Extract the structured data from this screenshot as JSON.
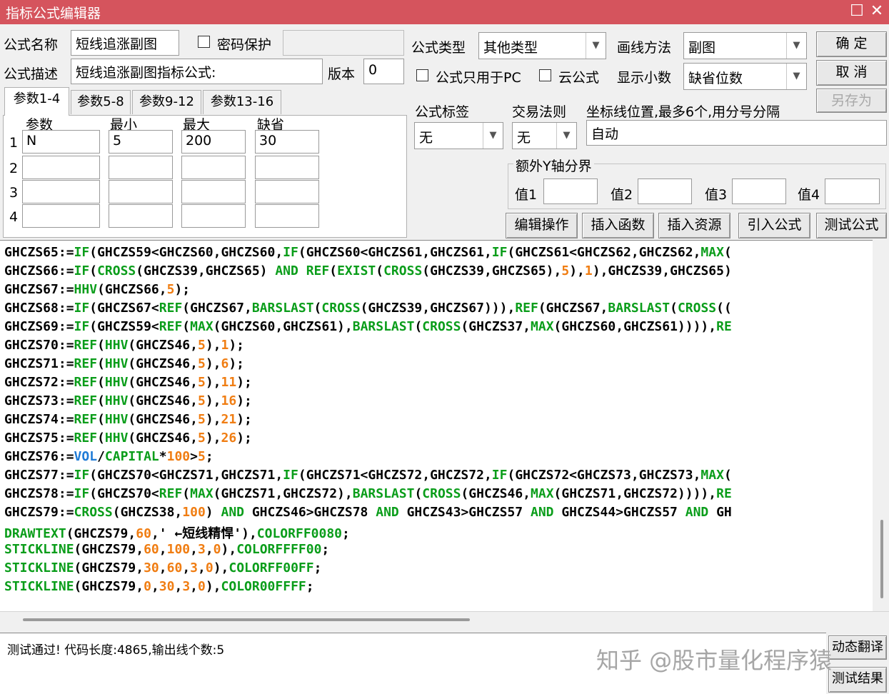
{
  "window": {
    "title": "指标公式编辑器",
    "maximize_icon": "☐",
    "close_icon": "✕"
  },
  "form": {
    "name_label": "公式名称",
    "name_value": "短线追涨副图",
    "password_label": "密码保护",
    "desc_label": "公式描述",
    "desc_value": "短线追涨副图指标公式:",
    "version_label": "版本",
    "version_value": "0",
    "type_label": "公式类型",
    "type_value": "其他类型",
    "draw_label": "画线方法",
    "draw_value": "副图",
    "pc_only_label": "公式只用于PC",
    "cloud_label": "云公式",
    "decimals_label": "显示小数",
    "decimals_value": "缺省位数",
    "tag_label": "公式标签",
    "tag_value": "无",
    "trade_label": "交易法则",
    "trade_value": "无",
    "axis_label": "坐标线位置,最多6个,用分号分隔",
    "axis_value": "自动",
    "yaxis_group_label": "额外Y轴分界",
    "y1_label": "值1",
    "y2_label": "值2",
    "y3_label": "值3",
    "y4_label": "值4"
  },
  "buttons": {
    "ok": "确  定",
    "cancel": "取  消",
    "save_as": "另存为",
    "edit": "编辑操作",
    "insert_func": "插入函数",
    "insert_res": "插入资源",
    "import": "引入公式",
    "test": "测试公式",
    "translate": "动态翻译",
    "test_result": "测试结果"
  },
  "params": {
    "tabs": [
      "参数1-4",
      "参数5-8",
      "参数9-12",
      "参数13-16"
    ],
    "headers": [
      "参数",
      "最小",
      "最大",
      "缺省"
    ],
    "rows": [
      {
        "no": "1",
        "name": "N",
        "min": "5",
        "max": "200",
        "default": "30"
      },
      {
        "no": "2",
        "name": "",
        "min": "",
        "max": "",
        "default": ""
      },
      {
        "no": "3",
        "name": "",
        "min": "",
        "max": "",
        "default": ""
      },
      {
        "no": "4",
        "name": "",
        "min": "",
        "max": "",
        "default": ""
      }
    ]
  },
  "code_lines": [
    [
      [
        "t",
        "GHCZS65:="
      ],
      [
        "k",
        "IF"
      ],
      [
        "t",
        "(GHCZS59<GHCZS60,GHCZS60,"
      ],
      [
        "k",
        "IF"
      ],
      [
        "t",
        "(GHCZS60<GHCZS61,GHCZS61,"
      ],
      [
        "k",
        "IF"
      ],
      [
        "t",
        "(GHCZS61<GHCZS62,GHCZS62,"
      ],
      [
        "k",
        "MAX"
      ],
      [
        "t",
        "("
      ]
    ],
    [
      [
        "t",
        "GHCZS66:="
      ],
      [
        "k",
        "IF"
      ],
      [
        "t",
        "("
      ],
      [
        "k",
        "CROSS"
      ],
      [
        "t",
        "(GHCZS39,GHCZS65) "
      ],
      [
        "k",
        "AND"
      ],
      [
        "t",
        " "
      ],
      [
        "k",
        "REF"
      ],
      [
        "t",
        "("
      ],
      [
        "k",
        "EXIST"
      ],
      [
        "t",
        "("
      ],
      [
        "k",
        "CROSS"
      ],
      [
        "t",
        "(GHCZS39,GHCZS65),"
      ],
      [
        "n",
        "5"
      ],
      [
        "t",
        "),"
      ],
      [
        "n",
        "1"
      ],
      [
        "t",
        "),GHCZS39,GHCZS65)"
      ]
    ],
    [
      [
        "t",
        "GHCZS67:="
      ],
      [
        "k",
        "HHV"
      ],
      [
        "t",
        "(GHCZS66,"
      ],
      [
        "n",
        "5"
      ],
      [
        "t",
        ");"
      ]
    ],
    [
      [
        "t",
        "GHCZS68:="
      ],
      [
        "k",
        "IF"
      ],
      [
        "t",
        "(GHCZS67<"
      ],
      [
        "k",
        "REF"
      ],
      [
        "t",
        "(GHCZS67,"
      ],
      [
        "k",
        "BARSLAST"
      ],
      [
        "t",
        "("
      ],
      [
        "k",
        "CROSS"
      ],
      [
        "t",
        "(GHCZS39,GHCZS67))),"
      ],
      [
        "k",
        "REF"
      ],
      [
        "t",
        "(GHCZS67,"
      ],
      [
        "k",
        "BARSLAST"
      ],
      [
        "t",
        "("
      ],
      [
        "k",
        "CROSS"
      ],
      [
        "t",
        "(("
      ]
    ],
    [
      [
        "t",
        "GHCZS69:="
      ],
      [
        "k",
        "IF"
      ],
      [
        "t",
        "(GHCZS59<"
      ],
      [
        "k",
        "REF"
      ],
      [
        "t",
        "("
      ],
      [
        "k",
        "MAX"
      ],
      [
        "t",
        "(GHCZS60,GHCZS61),"
      ],
      [
        "k",
        "BARSLAST"
      ],
      [
        "t",
        "("
      ],
      [
        "k",
        "CROSS"
      ],
      [
        "t",
        "(GHCZS37,"
      ],
      [
        "k",
        "MAX"
      ],
      [
        "t",
        "(GHCZS60,GHCZS61)))),"
      ],
      [
        "k",
        "RE"
      ]
    ],
    [
      [
        "t",
        "GHCZS70:="
      ],
      [
        "k",
        "REF"
      ],
      [
        "t",
        "("
      ],
      [
        "k",
        "HHV"
      ],
      [
        "t",
        "(GHCZS46,"
      ],
      [
        "n",
        "5"
      ],
      [
        "t",
        "),"
      ],
      [
        "n",
        "1"
      ],
      [
        "t",
        ");"
      ]
    ],
    [
      [
        "t",
        "GHCZS71:="
      ],
      [
        "k",
        "REF"
      ],
      [
        "t",
        "("
      ],
      [
        "k",
        "HHV"
      ],
      [
        "t",
        "(GHCZS46,"
      ],
      [
        "n",
        "5"
      ],
      [
        "t",
        "),"
      ],
      [
        "n",
        "6"
      ],
      [
        "t",
        ");"
      ]
    ],
    [
      [
        "t",
        "GHCZS72:="
      ],
      [
        "k",
        "REF"
      ],
      [
        "t",
        "("
      ],
      [
        "k",
        "HHV"
      ],
      [
        "t",
        "(GHCZS46,"
      ],
      [
        "n",
        "5"
      ],
      [
        "t",
        "),"
      ],
      [
        "n",
        "11"
      ],
      [
        "t",
        ");"
      ]
    ],
    [
      [
        "t",
        "GHCZS73:="
      ],
      [
        "k",
        "REF"
      ],
      [
        "t",
        "("
      ],
      [
        "k",
        "HHV"
      ],
      [
        "t",
        "(GHCZS46,"
      ],
      [
        "n",
        "5"
      ],
      [
        "t",
        "),"
      ],
      [
        "n",
        "16"
      ],
      [
        "t",
        ");"
      ]
    ],
    [
      [
        "t",
        "GHCZS74:="
      ],
      [
        "k",
        "REF"
      ],
      [
        "t",
        "("
      ],
      [
        "k",
        "HHV"
      ],
      [
        "t",
        "(GHCZS46,"
      ],
      [
        "n",
        "5"
      ],
      [
        "t",
        "),"
      ],
      [
        "n",
        "21"
      ],
      [
        "t",
        ");"
      ]
    ],
    [
      [
        "t",
        "GHCZS75:="
      ],
      [
        "k",
        "REF"
      ],
      [
        "t",
        "("
      ],
      [
        "k",
        "HHV"
      ],
      [
        "t",
        "(GHCZS46,"
      ],
      [
        "n",
        "5"
      ],
      [
        "t",
        "),"
      ],
      [
        "n",
        "26"
      ],
      [
        "t",
        ");"
      ]
    ],
    [
      [
        "t",
        "GHCZS76:="
      ],
      [
        "b",
        "VOL"
      ],
      [
        "t",
        "/"
      ],
      [
        "k",
        "CAPITAL"
      ],
      [
        "t",
        "*"
      ],
      [
        "n",
        "100"
      ],
      [
        "t",
        ">"
      ],
      [
        "n",
        "5"
      ],
      [
        "t",
        ";"
      ]
    ],
    [
      [
        "t",
        "GHCZS77:="
      ],
      [
        "k",
        "IF"
      ],
      [
        "t",
        "(GHCZS70<GHCZS71,GHCZS71,"
      ],
      [
        "k",
        "IF"
      ],
      [
        "t",
        "(GHCZS71<GHCZS72,GHCZS72,"
      ],
      [
        "k",
        "IF"
      ],
      [
        "t",
        "(GHCZS72<GHCZS73,GHCZS73,"
      ],
      [
        "k",
        "MAX"
      ],
      [
        "t",
        "("
      ]
    ],
    [
      [
        "t",
        "GHCZS78:="
      ],
      [
        "k",
        "IF"
      ],
      [
        "t",
        "(GHCZS70<"
      ],
      [
        "k",
        "REF"
      ],
      [
        "t",
        "("
      ],
      [
        "k",
        "MAX"
      ],
      [
        "t",
        "(GHCZS71,GHCZS72),"
      ],
      [
        "k",
        "BARSLAST"
      ],
      [
        "t",
        "("
      ],
      [
        "k",
        "CROSS"
      ],
      [
        "t",
        "(GHCZS46,"
      ],
      [
        "k",
        "MAX"
      ],
      [
        "t",
        "(GHCZS71,GHCZS72)))),"
      ],
      [
        "k",
        "RE"
      ]
    ],
    [
      [
        "t",
        "GHCZS79:="
      ],
      [
        "k",
        "CROSS"
      ],
      [
        "t",
        "(GHCZS38,"
      ],
      [
        "n",
        "100"
      ],
      [
        "t",
        ") "
      ],
      [
        "k",
        "AND"
      ],
      [
        "t",
        " GHCZS46>GHCZS78 "
      ],
      [
        "k",
        "AND"
      ],
      [
        "t",
        " GHCZS43>GHCZS57 "
      ],
      [
        "k",
        "AND"
      ],
      [
        "t",
        " GHCZS44>GHCZS57 "
      ],
      [
        "k",
        "AND"
      ],
      [
        "t",
        " GH"
      ]
    ],
    [
      [
        "k",
        "DRAWTEXT"
      ],
      [
        "t",
        "(GHCZS79,"
      ],
      [
        "n",
        "60"
      ],
      [
        "t",
        ",' ←短线精悍'),"
      ],
      [
        "k",
        "COLORFF0080"
      ],
      [
        "t",
        ";"
      ]
    ],
    [
      [
        "k",
        "STICKLINE"
      ],
      [
        "t",
        "(GHCZS79,"
      ],
      [
        "n",
        "60"
      ],
      [
        "t",
        ","
      ],
      [
        "n",
        "100"
      ],
      [
        "t",
        ","
      ],
      [
        "n",
        "3"
      ],
      [
        "t",
        ","
      ],
      [
        "n",
        "0"
      ],
      [
        "t",
        "),"
      ],
      [
        "k",
        "COLORFFFF00"
      ],
      [
        "t",
        ";"
      ]
    ],
    [
      [
        "k",
        "STICKLINE"
      ],
      [
        "t",
        "(GHCZS79,"
      ],
      [
        "n",
        "30"
      ],
      [
        "t",
        ","
      ],
      [
        "n",
        "60"
      ],
      [
        "t",
        ","
      ],
      [
        "n",
        "3"
      ],
      [
        "t",
        ","
      ],
      [
        "n",
        "0"
      ],
      [
        "t",
        "),"
      ],
      [
        "k",
        "COLORFF00FF"
      ],
      [
        "t",
        ";"
      ]
    ],
    [
      [
        "k",
        "STICKLINE"
      ],
      [
        "t",
        "(GHCZS79,"
      ],
      [
        "n",
        "0"
      ],
      [
        "t",
        ","
      ],
      [
        "n",
        "30"
      ],
      [
        "t",
        ","
      ],
      [
        "n",
        "3"
      ],
      [
        "t",
        ","
      ],
      [
        "n",
        "0"
      ],
      [
        "t",
        "),"
      ],
      [
        "k",
        "COLOR00FFFF"
      ],
      [
        "t",
        ";"
      ]
    ]
  ],
  "status": {
    "message": "测试通过! 代码长度:4865,输出线个数:5"
  },
  "watermark": "知乎 @股市量化程序猿"
}
